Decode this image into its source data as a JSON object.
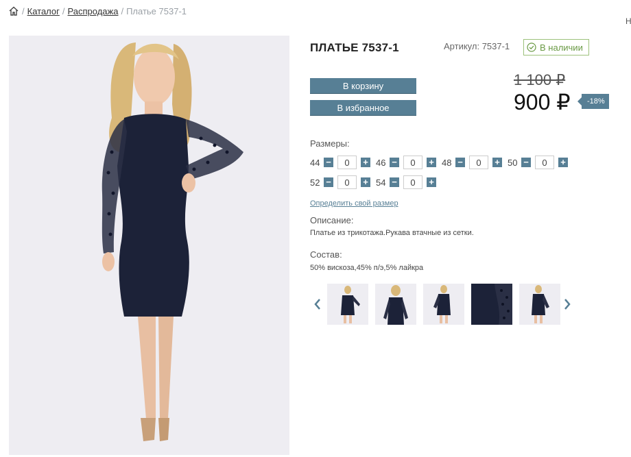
{
  "breadcrumb": {
    "home_icon": "home-icon",
    "separator": "/",
    "items": [
      "Каталог",
      "Распродажа"
    ],
    "current": "Платье 7537-1"
  },
  "edge_text": "Н",
  "product": {
    "title": "ПЛАТЬЕ 7537-1",
    "sku": "Артикул: 7537-1",
    "stock": "В наличии",
    "old_price": "1 100 ₽",
    "price": "900 ₽",
    "discount": "-18%"
  },
  "buttons": {
    "cart": "В корзину",
    "favorites": "В избранное"
  },
  "sizes": {
    "label": "Размеры:",
    "items": [
      {
        "size": "44",
        "qty": "0"
      },
      {
        "size": "46",
        "qty": "0"
      },
      {
        "size": "48",
        "qty": "0"
      },
      {
        "size": "50",
        "qty": "0"
      },
      {
        "size": "52",
        "qty": "0"
      },
      {
        "size": "54",
        "qty": "0"
      }
    ],
    "minus": "−",
    "plus": "+"
  },
  "size_link": "Определить свой размер",
  "description": {
    "label": "Описание:",
    "text": "Платье из трикотажа.Рукава втачные из сетки."
  },
  "composition": {
    "label": "Состав:",
    "text": "50% вискоза,45% п/э,5% лайкра"
  },
  "colors": {
    "accent": "#577f95",
    "stock_green": "#6a9a45",
    "dress": "#1c2238"
  }
}
